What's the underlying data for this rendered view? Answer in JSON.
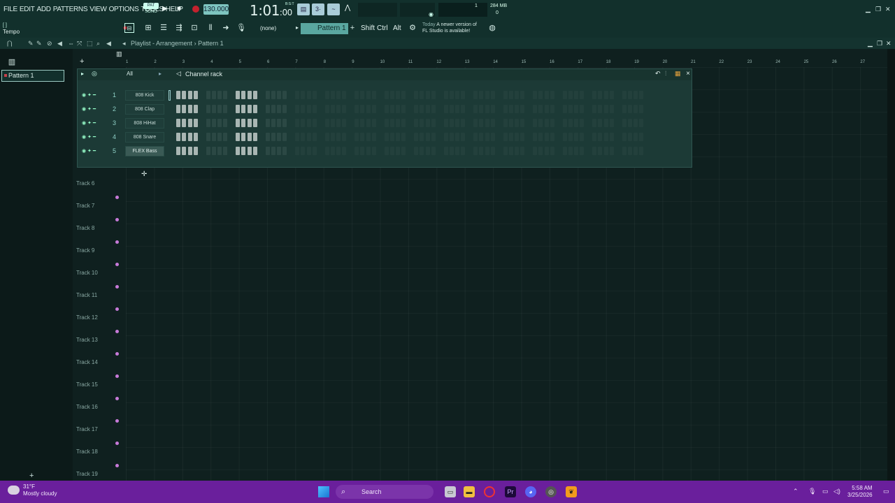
{
  "menu": [
    "FILE",
    "EDIT",
    "ADD",
    "PATTERNS",
    "VIEW",
    "OPTIONS",
    "TOOLS",
    "HELP"
  ],
  "songpat": {
    "top": "PAT",
    "bottom": "SONG"
  },
  "transport": {
    "tempo": "130.000",
    "time": "1:01",
    "time_small": ":00",
    "time_unit": "B:S:T"
  },
  "meter": {
    "value": "1",
    "mem": "284 MB",
    "voices": "0"
  },
  "bar2": {
    "hint": "[ ]",
    "tempo_label": "Tempo",
    "snap": "(none)",
    "pattern": "Pattern 1",
    "keys": [
      "Shift",
      "Ctrl",
      "Alt"
    ],
    "news_prefix": "Today",
    "news_line1": "A newer version of",
    "news_line2": "FL Studio is available!"
  },
  "playlist": {
    "title": "Playlist - Arrangement",
    "sep": "›",
    "pattern": "Pattern 1"
  },
  "picker": {
    "pattern_item": "Pattern 1",
    "add": "+"
  },
  "ruler": [
    "1",
    "2",
    "3",
    "4",
    "5",
    "6",
    "7",
    "8",
    "9",
    "10",
    "11",
    "12",
    "13",
    "14",
    "15",
    "16",
    "17",
    "18",
    "19",
    "20",
    "21",
    "22",
    "23",
    "24",
    "25",
    "26",
    "27"
  ],
  "tracks": [
    "Track 6",
    "Track 7",
    "Track 8",
    "Track 9",
    "Track 10",
    "Track 11",
    "Track 12",
    "Track 13",
    "Track 14",
    "Track 15",
    "Track 16",
    "Track 17",
    "Track 18",
    "Track 19"
  ],
  "channel_rack": {
    "title": "Channel rack",
    "filter": "All",
    "close": "×",
    "channels": [
      {
        "num": "1",
        "name": "808 Kick"
      },
      {
        "num": "2",
        "name": "808 Clap"
      },
      {
        "num": "3",
        "name": "808 HiHat"
      },
      {
        "num": "4",
        "name": "808 Snare"
      },
      {
        "num": "5",
        "name": "FLEX Bass"
      }
    ]
  },
  "taskbar": {
    "temp": "31°F",
    "condition": "Mostly cloudy",
    "search": "Search",
    "time": "5:58 AM",
    "date": "3/25/2026"
  },
  "colors": {
    "bg": "#0d1c1b",
    "panel": "#12302c",
    "accent": "#5aa7a0",
    "taskbar": "#6a1f9c",
    "record": "#c4222e"
  }
}
